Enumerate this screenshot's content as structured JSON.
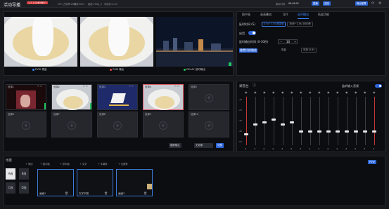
{
  "header": {
    "title": "活动导播",
    "status_badge": "1.2.1.00606617",
    "cpu": "CPU 占用率:26%",
    "delay": "网络:6ms",
    "mode": "画面:720p_3",
    "extra": "可用存:2.3G",
    "time_label": "剩余时间",
    "time": "00:46:02",
    "btn1": "直播",
    "btn2": "连接",
    "btn3": "输出配置"
  },
  "monitor": {
    "pvw_label": "PVW 预监",
    "pgm_label": "PGM 输出",
    "delay_label": "DELAY 延时输出",
    "colors": {
      "pvw": "#3b82f6",
      "pgm": "#ef4444",
      "delay": "#22c55e"
    }
  },
  "sources": [
    {
      "name": "信源1",
      "icons": "⊙ ⊙"
    },
    {
      "name": "信源2",
      "icons": "⊙ ⊙"
    },
    {
      "name": "信源3",
      "icons": "⊙ ⊙"
    },
    {
      "name": "信源4",
      "icons": "⊙ ⊙"
    },
    {
      "name": "信源5",
      "icons": ""
    },
    {
      "name": "信源6",
      "icons": ""
    },
    {
      "name": "信源7",
      "icons": ""
    },
    {
      "name": "信源8",
      "icons": ""
    },
    {
      "name": "信源9",
      "icons": ""
    },
    {
      "name": "信源10",
      "icons": ""
    }
  ],
  "source_bar": {
    "out_btn": "横屏输出",
    "select": "无效果",
    "cut_btn": "切换"
  },
  "right_tabs": [
    "插中画",
    "画画叠加",
    "导片",
    "延时播出",
    "拓展功能"
  ],
  "delay_panel": {
    "delay_label": "延时时间 (S)",
    "opt1": "0.5s~1.5s 固定值",
    "opt2": "30秒~1.5s 3000秒",
    "enable_label": "启用",
    "range_label": "延时输出时间 (0-30秒)",
    "minus": "−",
    "value": "10",
    "plus": "+",
    "clear_label": "重置切换播放",
    "btn_a": "恢复",
    "btn_b": "可用 (2.8)"
  },
  "mixer": {
    "title": "调音台",
    "monitor_label": "监听输入音频",
    "scale": [
      "-10",
      "-20",
      "-30",
      "-40",
      "-50"
    ],
    "values": [
      0.25,
      0.45,
      0.5,
      0.55,
      0.45,
      0.5,
      0.3,
      0.3,
      0.3,
      0.3,
      0.3,
      0.3,
      0.3,
      0.3,
      0.3
    ]
  },
  "scene_panel": {
    "title": "场景",
    "toolbar": [
      "+ 添加",
      "+ 插中画",
      "+ 导中画",
      "+ 文字",
      "+ 字幕条",
      "+ 位置条"
    ],
    "pvw_btn": "PVW",
    "layouts": [
      "A画",
      "B画",
      "C画",
      "D画"
    ],
    "scenes": [
      {
        "name": "画面1"
      },
      {
        "name": "文字字幕"
      },
      {
        "name": "画面3"
      }
    ]
  }
}
